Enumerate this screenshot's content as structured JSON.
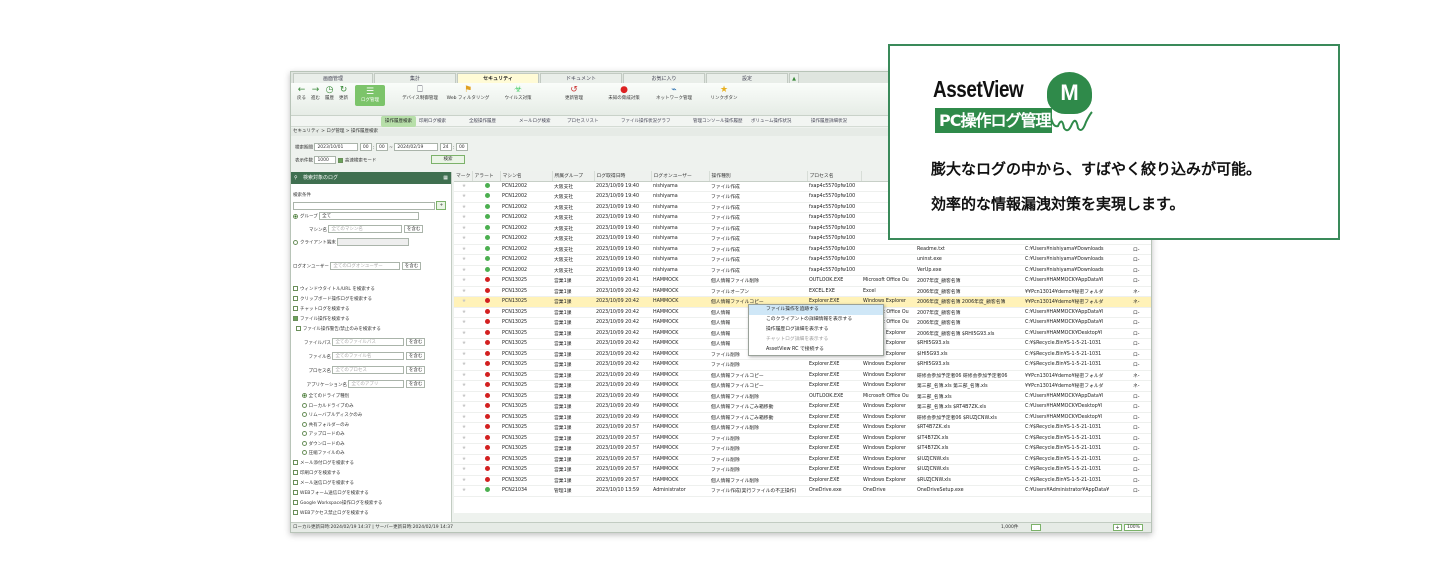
{
  "tabs": [
    "画面管理",
    "集計",
    "セキュリティ",
    "ドキュメント",
    "お気に入り",
    "設定"
  ],
  "toolbar": {
    "nav": [
      "戻る",
      "進む",
      "履歴",
      "更新"
    ],
    "buttons": [
      "ログ管理",
      "デバイス制御管理",
      "Web フィルタリング",
      "ウイルス対策",
      "更新管理",
      "未知の脅威対策",
      "ネットワーク管理",
      "リンクボタン"
    ]
  },
  "subbar": [
    "操作履歴検索",
    "印刷ログ検索",
    "全般操作履歴",
    "メールログ検索",
    "プロセスリスト",
    "ファイル操作状況グラフ",
    "管理コンソール操作履歴",
    "ボリューム操作状況",
    "操作履歴詳細状況"
  ],
  "breadcrumb": "セキュリティ > ログ管理 > 操作履歴検索",
  "filters": {
    "period_label": "検索期間",
    "date_from": "2023/10/01",
    "h_from": "00",
    "m_from": "00",
    "date_to": "2024/02/19",
    "h_to": "24",
    "m_to": "00",
    "count_label": "表示件数",
    "count": "1000",
    "fast_mode": "高速検索モード",
    "search_button": "検索"
  },
  "side": {
    "title": "検索対象のログ",
    "cond_label": "検索条件",
    "group_label": "グループ",
    "group_value": "全て",
    "machine_label": "マシン名",
    "machine_placeholder": "全てのマシン名",
    "contains": "を含む",
    "client_label": "クライアント端末",
    "user_label": "ログオンユーザー",
    "user_placeholder": "全てのログオンユーザー",
    "items": [
      "ウィンドウタイトル/URL を検索する",
      "クリップボード操作ログを検索する",
      "チャットログを検索する",
      "ファイル操作を検索する"
    ],
    "file_sub": "ファイル操作警告/禁止のみを検索する",
    "path_label": "ファイルパス",
    "path_placeholder": "全てのファイルパス",
    "name_label": "ファイル名",
    "name_placeholder": "全てのファイル名",
    "proc_label": "プロセス名",
    "proc_placeholder": "全てのプロセス",
    "app_label": "アプリケーション名",
    "app_placeholder": "全てのアプリ",
    "radios": [
      "全てのドライブ種別",
      "ローカルドライブのみ",
      "リムーバブルディスクのみ",
      "共有フォルダーのみ",
      "アップロードのみ",
      "ダウンロードのみ",
      "圧縮ファイルのみ"
    ],
    "items2": [
      "メール添付ログを検索する",
      "印刷ログを検索する",
      "メール送信ログを検索する",
      "WEBフォーム送信ログを検索する",
      "Google Workspace操作ログを検索する",
      "WEBアクセス禁止ログを検索する"
    ]
  },
  "grid": {
    "headers": [
      "マーク",
      "アラート",
      "マシン名",
      "所属グループ",
      "ログ取得日時",
      "ログオンユーザー",
      "操作種別",
      "プロセス名",
      "",
      "",
      "",
      ""
    ],
    "rows": [
      [
        "g",
        "PCN12002",
        "大阪支社",
        "2023/10/09 19:40",
        "nishiyama",
        "ファイル作成",
        "fxap4c5570pfw100",
        "",
        "",
        "",
        ""
      ],
      [
        "g",
        "PCN12002",
        "大阪支社",
        "2023/10/09 19:40",
        "nishiyama",
        "ファイル作成",
        "fxap4c5570pfw100",
        "",
        "",
        "",
        ""
      ],
      [
        "g",
        "PCN12002",
        "大阪支社",
        "2023/10/09 19:40",
        "nishiyama",
        "ファイル作成",
        "fxap4c5570pfw100",
        "",
        "",
        "",
        ""
      ],
      [
        "g",
        "PCN12002",
        "大阪支社",
        "2023/10/09 19:40",
        "nishiyama",
        "ファイル作成",
        "fxap4c5570pfw100",
        "",
        "",
        "",
        ""
      ],
      [
        "g",
        "PCN12002",
        "大阪支社",
        "2023/10/09 19:40",
        "nishiyama",
        "ファイル作成",
        "fxap4c5570pfw100",
        "",
        "",
        "",
        ""
      ],
      [
        "g",
        "PCN12002",
        "大阪支社",
        "2023/10/09 19:40",
        "nishiyama",
        "ファイル作成",
        "fxap4c5570pfw100",
        "",
        "",
        "",
        ""
      ],
      [
        "g",
        "PCN12002",
        "大阪支社",
        "2023/10/09 19:40",
        "nishiyama",
        "ファイル作成",
        "fxap4c5570pfw100",
        "",
        "Readme.txt",
        "C:¥Users¥nishiyama¥Downloads",
        "ロ-"
      ],
      [
        "g",
        "PCN12002",
        "大阪支社",
        "2023/10/09 19:40",
        "nishiyama",
        "ファイル作成",
        "fxap4c5570pfw100",
        "",
        "uninst.exe",
        "C:¥Users¥nishiyama¥Downloads",
        "ロ-"
      ],
      [
        "g",
        "PCN12002",
        "大阪支社",
        "2023/10/09 19:40",
        "nishiyama",
        "ファイル作成",
        "fxap4c5570pfw100",
        "",
        "VerUp.exe",
        "C:¥Users¥nishiyama¥Downloads",
        "ロ-"
      ],
      [
        "r",
        "PCN13025",
        "営業1課",
        "2023/10/09 20:41",
        "HAMMOCK",
        "個人情報ファイル削除",
        "OUTLOOK.EXE",
        "Microsoft Office Ou",
        "2007年度_顧客名簿",
        "C:¥Users¥HAMMOCK¥AppData¥l",
        "ロ-"
      ],
      [
        "r",
        "PCN13025",
        "営業1課",
        "2023/10/09 20:42",
        "HAMMOCK",
        "ファイルオープン",
        "EXCEL.EXE",
        "Excel",
        "2006年度_顧客名簿",
        "¥¥Pcn13014¥demo¥秘密フォルダ",
        "ネ-"
      ],
      [
        "r",
        "PCN13025",
        "営業1課",
        "2023/10/09 20:42",
        "HAMMOCK",
        "個人情報ファイルコピー",
        "Explorer.EXE",
        "Windows Explorer",
        "2006年度_顧客名簿 2006年度_顧客名簿",
        "¥¥Pcn13014¥demo¥秘密フォルダ",
        "ネ-"
      ],
      [
        "r",
        "PCN13025",
        "営業1課",
        "2023/10/09 20:42",
        "HAMMOCK",
        "個人情報",
        "",
        "Microsoft Office Ou",
        "2007年度_顧客名簿",
        "C:¥Users¥HAMMOCK¥AppData¥l",
        "ロ-"
      ],
      [
        "r",
        "PCN13025",
        "営業1課",
        "2023/10/09 20:42",
        "HAMMOCK",
        "個人情報",
        "",
        "Microsoft Office Ou",
        "2006年度_顧客名簿",
        "C:¥Users¥HAMMOCK¥AppData¥l",
        "ロ-"
      ],
      [
        "r",
        "PCN13025",
        "営業1課",
        "2023/10/09 20:42",
        "HAMMOCK",
        "個人情報",
        "",
        "Windows Explorer",
        "2006年度_顧客名簿 $RHI5G93.xls",
        "C:¥Users¥HAMMOCK¥Desktop¥l",
        "ロ-"
      ],
      [
        "r",
        "PCN13025",
        "営業1課",
        "2023/10/09 20:42",
        "HAMMOCK",
        "個人情報",
        "",
        "Windows Explorer",
        "$RHI5G93.xls",
        "C:¥$Recycle.Bin¥S-1-5-21-1031",
        "ロ-"
      ],
      [
        "r",
        "PCN13025",
        "営業1課",
        "2023/10/09 20:42",
        "HAMMOCK",
        "ファイル削除",
        "Explorer.EXE",
        "Windows Explorer",
        "$IHI5G93.xls",
        "C:¥$Recycle.Bin¥S-1-5-21-1031",
        "ロ-"
      ],
      [
        "r",
        "PCN13025",
        "営業1課",
        "2023/10/09 20:42",
        "HAMMOCK",
        "ファイル削除",
        "Explorer.EXE",
        "Windows Explorer",
        "$RHI5G93.xls",
        "C:¥$Recycle.Bin¥S-1-5-21-1031",
        "ロ-"
      ],
      [
        "r",
        "PCN13025",
        "営業1課",
        "2023/10/09 20:49",
        "HAMMOCK",
        "個人情報ファイルコピー",
        "Explorer.EXE",
        "Windows Explorer",
        "研修会参加予定者06 研修会参加予定者06",
        "¥¥Pcn13014¥demo¥秘密フォルダ",
        "ネ-"
      ],
      [
        "r",
        "PCN13025",
        "営業1課",
        "2023/10/09 20:49",
        "HAMMOCK",
        "個人情報ファイルコピー",
        "Explorer.EXE",
        "Windows Explorer",
        "第三部_名簿.xls 第三部_名簿.xls",
        "¥¥Pcn13014¥demo¥秘密フォルダ",
        "ネ-"
      ],
      [
        "r",
        "PCN13025",
        "営業1課",
        "2023/10/09 20:49",
        "HAMMOCK",
        "個人情報ファイル削除",
        "OUTLOOK.EXE",
        "Microsoft Office Ou",
        "第三部_名簿.xls",
        "C:¥Users¥HAMMOCK¥AppData¥l",
        "ロ-"
      ],
      [
        "r",
        "PCN13025",
        "営業1課",
        "2023/10/09 20:49",
        "HAMMOCK",
        "個人情報ファイルごみ箱移動",
        "Explorer.EXE",
        "Windows Explorer",
        "第三部_名簿.xls $RT4B7ZK.xls",
        "C:¥Users¥HAMMOCK¥Desktop¥l",
        "ロ-"
      ],
      [
        "r",
        "PCN13025",
        "営業1課",
        "2023/10/09 20:49",
        "HAMMOCK",
        "個人情報ファイルごみ箱移動",
        "Explorer.EXE",
        "Windows Explorer",
        "研修会参加予定者06 $RUZJCNW.xls",
        "C:¥Users¥HAMMOCK¥Desktop¥l",
        "ロ-"
      ],
      [
        "r",
        "PCN13025",
        "営業1課",
        "2023/10/09 20:57",
        "HAMMOCK",
        "個人情報ファイル削除",
        "Explorer.EXE",
        "Windows Explorer",
        "$RT4B7ZK.xls",
        "C:¥$Recycle.Bin¥S-1-5-21-1031",
        "ロ-"
      ],
      [
        "r",
        "PCN13025",
        "営業1課",
        "2023/10/09 20:57",
        "HAMMOCK",
        "ファイル削除",
        "Explorer.EXE",
        "Windows Explorer",
        "$IT4B7ZK.xls",
        "C:¥$Recycle.Bin¥S-1-5-21-1031",
        "ロ-"
      ],
      [
        "r",
        "PCN13025",
        "営業1課",
        "2023/10/09 20:57",
        "HAMMOCK",
        "ファイル削除",
        "Explorer.EXE",
        "Windows Explorer",
        "$IT4B7ZK.xls",
        "C:¥$Recycle.Bin¥S-1-5-21-1031",
        "ロ-"
      ],
      [
        "r",
        "PCN13025",
        "営業1課",
        "2023/10/09 20:57",
        "HAMMOCK",
        "ファイル削除",
        "Explorer.EXE",
        "Windows Explorer",
        "$IUZJCNW.xls",
        "C:¥$Recycle.Bin¥S-1-5-21-1031",
        "ロ-"
      ],
      [
        "r",
        "PCN13025",
        "営業1課",
        "2023/10/09 20:57",
        "HAMMOCK",
        "ファイル削除",
        "Explorer.EXE",
        "Windows Explorer",
        "$IUZJCNW.xls",
        "C:¥$Recycle.Bin¥S-1-5-21-1031",
        "ロ-"
      ],
      [
        "r",
        "PCN13025",
        "営業1課",
        "2023/10/09 20:57",
        "HAMMOCK",
        "個人情報ファイル削除",
        "Explorer.EXE",
        "Windows Explorer",
        "$RUZJCNW.xls",
        "C:¥$Recycle.Bin¥S-1-5-21-1031",
        "ロ-"
      ],
      [
        "g",
        "PCN21034",
        "管理1課",
        "2023/10/10 13:59",
        "Administrator",
        "ファイル作成(実行ファイルの不正操作)",
        "OneDrive.exe",
        "OneDrive",
        "OneDriveSetup.exe",
        "C:¥Users¥Administrator¥AppData¥",
        "ロ-"
      ]
    ],
    "selected_row": 11
  },
  "context_menu": [
    "ファイル操作を追跡する",
    "このクライアントの詳細情報を表示する",
    "操作履歴ログ詳細を表示する",
    "チャットログ詳細を表示する",
    "AssetView RC で接続する"
  ],
  "status": {
    "left": "ローカル更新日時:2024/02/19 14:37 | サーバー更新日時:2024/02/19 14:37",
    "count": "1,000件",
    "zoom": "100%"
  },
  "callout": {
    "logo": "AssetView",
    "badge": "PC操作ログ管理",
    "letter": "M",
    "line1": "膨大なログの中から、すばやく絞り込みが可能。",
    "line2": "効率的な情報漏洩対策を実現します。"
  },
  "colors": {
    "brand": "#2f8a4a",
    "accent": "#7cc46a",
    "alert_green": "#4caf50",
    "alert_red": "#d32020"
  }
}
